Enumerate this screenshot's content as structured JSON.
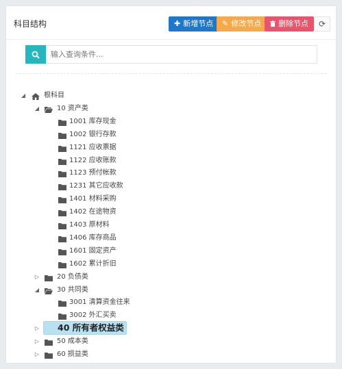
{
  "header": {
    "title": "科目结构",
    "buttons": {
      "add": "新增节点",
      "edit": "修改节点",
      "delete": "删除节点"
    }
  },
  "search": {
    "placeholder": "输入查询条件..."
  },
  "colors": {
    "add": "#1f77c9",
    "edit": "#f5a94b",
    "delete": "#e8546b",
    "search": "#26b6be",
    "selected": "#b9e1f1"
  },
  "tree": [
    {
      "level": 0,
      "toggle": "expanded",
      "icon": "home-icon",
      "label": "根科目"
    },
    {
      "level": 1,
      "toggle": "expanded",
      "icon": "folder-open-icon",
      "label": "10 资产类"
    },
    {
      "level": 2,
      "toggle": "none",
      "icon": "folder-icon",
      "label": "1001 库存现金"
    },
    {
      "level": 2,
      "toggle": "none",
      "icon": "folder-icon",
      "label": "1002 银行存款"
    },
    {
      "level": 2,
      "toggle": "none",
      "icon": "folder-icon",
      "label": "1121 应收票据"
    },
    {
      "level": 2,
      "toggle": "none",
      "icon": "folder-icon",
      "label": "1122 应收账款"
    },
    {
      "level": 2,
      "toggle": "none",
      "icon": "folder-icon",
      "label": "1123 预付帐款"
    },
    {
      "level": 2,
      "toggle": "none",
      "icon": "folder-icon",
      "label": "1231 其它应收款"
    },
    {
      "level": 2,
      "toggle": "none",
      "icon": "folder-icon",
      "label": "1401 材料采购"
    },
    {
      "level": 2,
      "toggle": "none",
      "icon": "folder-icon",
      "label": "1402 在途物资"
    },
    {
      "level": 2,
      "toggle": "none",
      "icon": "folder-icon",
      "label": "1403 原材料"
    },
    {
      "level": 2,
      "toggle": "none",
      "icon": "folder-icon",
      "label": "1406 库存商品"
    },
    {
      "level": 2,
      "toggle": "none",
      "icon": "folder-icon",
      "label": "1601 固定资产"
    },
    {
      "level": 2,
      "toggle": "none",
      "icon": "folder-icon",
      "label": "1602 累计折旧"
    },
    {
      "level": 1,
      "toggle": "collapsed",
      "icon": "folder-icon",
      "label": "20 负债类"
    },
    {
      "level": 1,
      "toggle": "expanded",
      "icon": "folder-open-icon",
      "label": "30 共同类"
    },
    {
      "level": 2,
      "toggle": "none",
      "icon": "folder-icon",
      "label": "3001 清算资金往来"
    },
    {
      "level": 2,
      "toggle": "none",
      "icon": "folder-icon",
      "label": "3002 外汇买卖"
    },
    {
      "level": 1,
      "toggle": "collapsed",
      "icon": "folder-icon",
      "label": "40 所有者权益类",
      "selected": true
    },
    {
      "level": 1,
      "toggle": "collapsed",
      "icon": "folder-icon",
      "label": "50 成本类"
    },
    {
      "level": 1,
      "toggle": "collapsed",
      "icon": "folder-icon",
      "label": "60 损益类"
    }
  ]
}
